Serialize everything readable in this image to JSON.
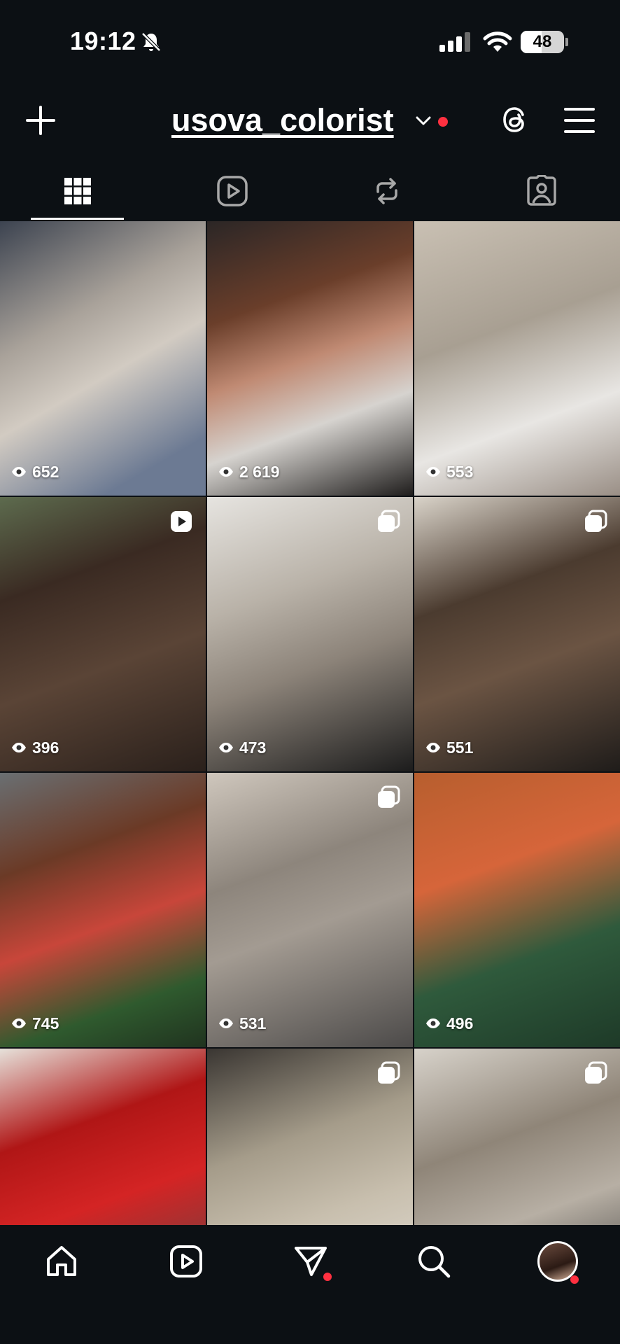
{
  "status": {
    "time": "19:12",
    "battery": "48",
    "battery_level": 0.48
  },
  "header": {
    "username": "usova_colorist"
  },
  "tabs": [
    {
      "name": "posts-grid",
      "active": true
    },
    {
      "name": "reels",
      "active": false
    },
    {
      "name": "reposts",
      "active": false
    },
    {
      "name": "tagged",
      "active": false
    }
  ],
  "posts": [
    {
      "views": "652",
      "badge": ""
    },
    {
      "views": "2 619",
      "badge": ""
    },
    {
      "views": "553",
      "badge": ""
    },
    {
      "views": "396",
      "badge": "reel-icon"
    },
    {
      "views": "473",
      "badge": "carousel-icon"
    },
    {
      "views": "551",
      "badge": "carousel-icon"
    },
    {
      "views": "745",
      "badge": ""
    },
    {
      "views": "531",
      "badge": "carousel-icon"
    },
    {
      "views": "496",
      "badge": ""
    },
    {
      "views": "",
      "badge": ""
    },
    {
      "views": "",
      "badge": "carousel-icon"
    },
    {
      "views": "",
      "badge": "carousel-icon"
    }
  ],
  "bottom_nav": [
    "home-icon",
    "reels-icon",
    "direct-icon",
    "search-icon",
    "profile-avatar"
  ],
  "colors": {
    "background": "#0c1014",
    "notification": "#ff3040",
    "text": "#ffffff"
  }
}
